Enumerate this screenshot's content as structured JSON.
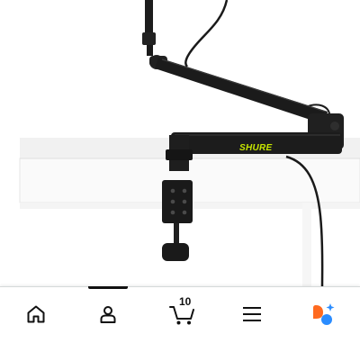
{
  "product_image": {
    "brand_text": "SHURE",
    "brand_color": "#c7e600"
  },
  "bottom_nav": {
    "items": [
      {
        "icon": "home-icon"
      },
      {
        "icon": "account-icon"
      },
      {
        "icon": "cart-icon",
        "count": "10"
      },
      {
        "icon": "menu-icon"
      },
      {
        "icon": "assistant-icon"
      }
    ],
    "active_index": 1,
    "colors": {
      "icon": "#111111",
      "assistant_orange": "#ff6a1f",
      "assistant_blue": "#2a8cff"
    }
  }
}
